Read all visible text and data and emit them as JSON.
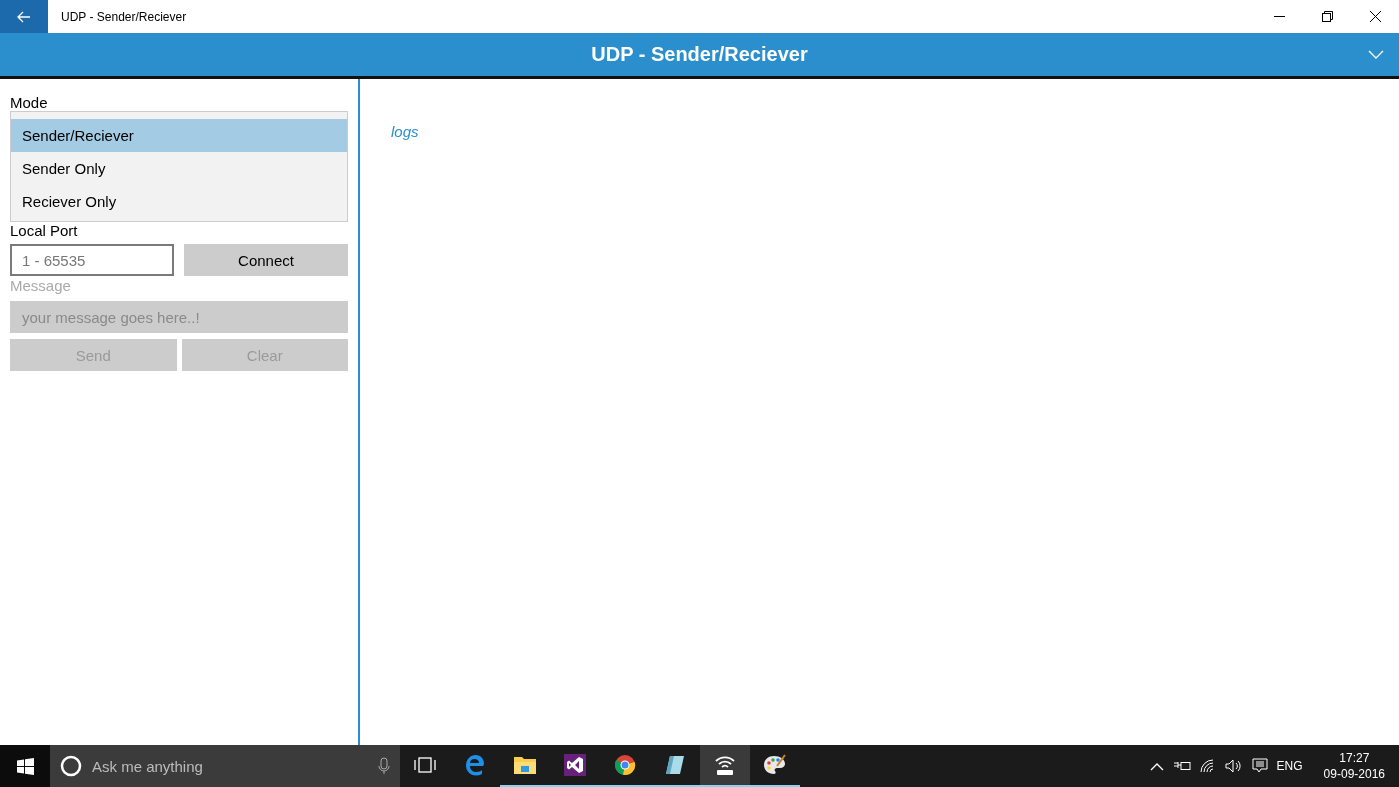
{
  "window": {
    "title": "UDP - Sender/Reciever"
  },
  "header": {
    "title": "UDP - Sender/Reciever"
  },
  "mode": {
    "label": "Mode",
    "expanded": true,
    "options": [
      {
        "label": "Sender/Reciever",
        "selected": true
      },
      {
        "label": "Sender Only",
        "selected": false
      },
      {
        "label": "Reciever Only",
        "selected": false
      }
    ]
  },
  "local_port": {
    "label": "Local Port",
    "placeholder": "1 - 65535"
  },
  "connect_button": {
    "label": "Connect",
    "disabled": false
  },
  "message": {
    "label": "Message",
    "placeholder": "your message goes here..!",
    "disabled": true
  },
  "buttons": [
    {
      "label": "Send",
      "disabled": true
    },
    {
      "label": "Clear",
      "disabled": true
    }
  ],
  "logs": "logs",
  "taskbar": {
    "search_placeholder": "Ask me anything",
    "apps": [
      {
        "kind": "taskview",
        "running": false,
        "active": false
      },
      {
        "kind": "edge",
        "running": false,
        "active": false
      },
      {
        "kind": "explorer",
        "running": true,
        "active": false
      },
      {
        "kind": "studio",
        "running": true,
        "active": false
      },
      {
        "kind": "chrome",
        "running": true,
        "active": false
      },
      {
        "kind": "notepad",
        "running": true,
        "active": false
      },
      {
        "kind": "udp",
        "running": true,
        "active": true
      },
      {
        "kind": "paint",
        "running": true,
        "active": false
      }
    ],
    "tray": {
      "language": "ENG",
      "time": "17:27",
      "date": "09-09-2016"
    }
  }
}
